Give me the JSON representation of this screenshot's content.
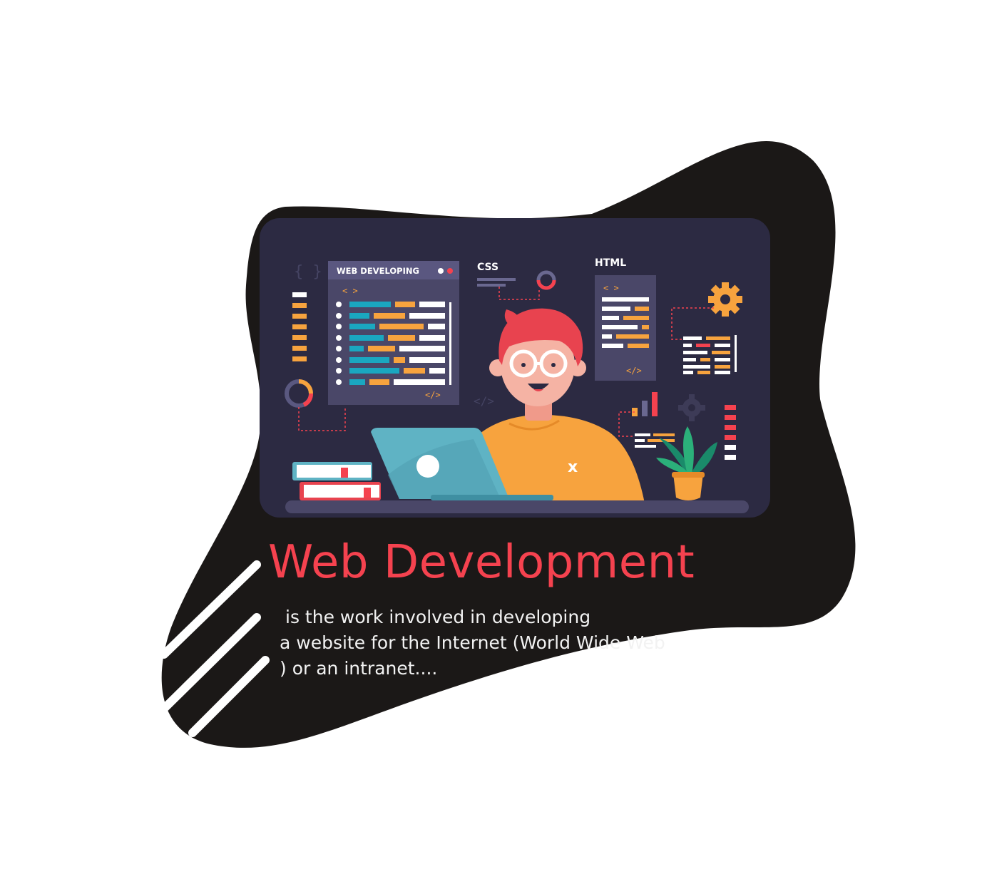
{
  "colors": {
    "blob": "#1b1817",
    "panel": "#2c2a42",
    "accent_red": "#f5424f",
    "orange": "#f7a33e",
    "teal": "#1aa7c0",
    "white": "#ffffff"
  },
  "illustration": {
    "window_title": "WEB DEVELOPING",
    "css_label": "CSS",
    "html_label": "HTML",
    "open_tag": "< >",
    "close_tag": "</>",
    "laptop_glyph": "x"
  },
  "headline": "Web Development",
  "description": {
    "line1": "is the work involved in developing",
    "line2": "a website for the Internet (World Wide Web",
    "line3": ") or an intranet...."
  },
  "icons": [
    "gear-icon",
    "plant-icon",
    "books-icon",
    "laptop-icon",
    "bar-chart-icon",
    "donut-chart-icon"
  ]
}
